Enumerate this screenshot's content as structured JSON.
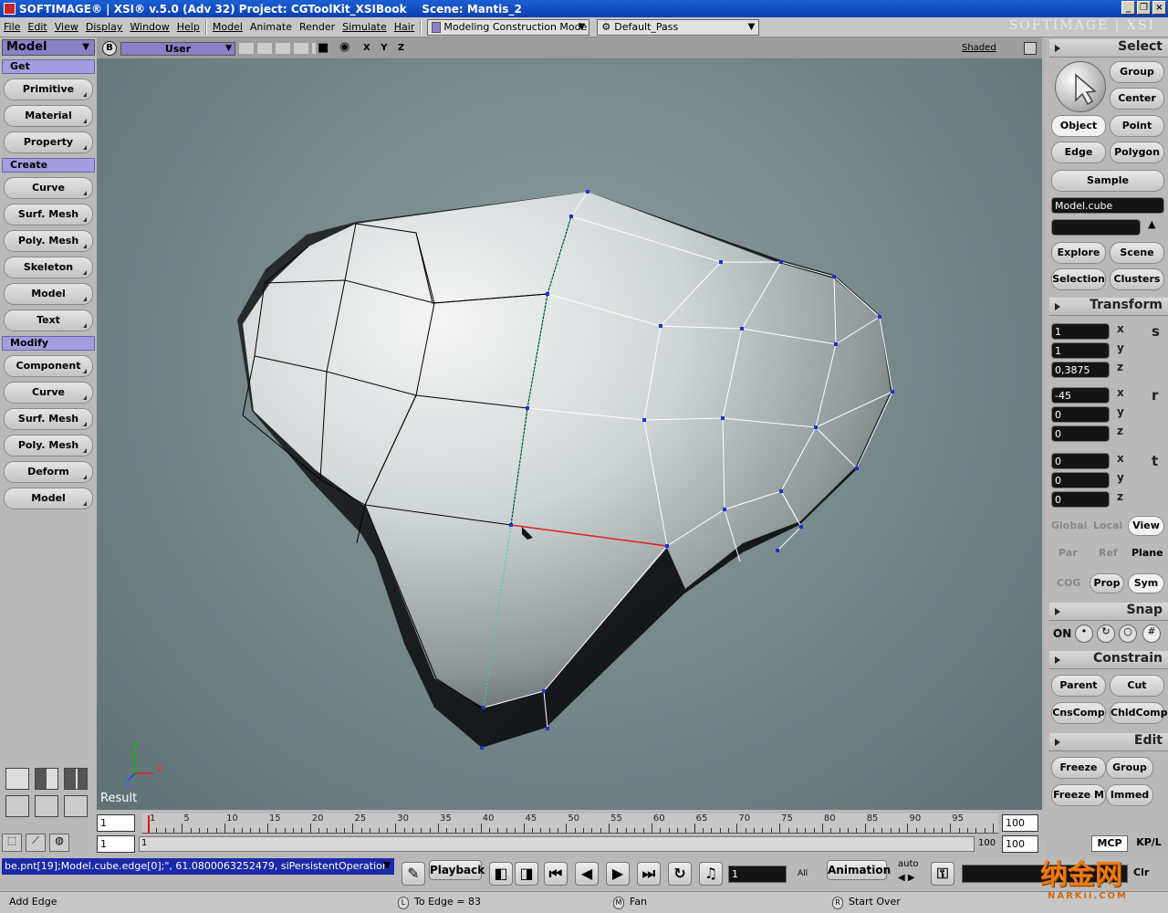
{
  "titlebar": {
    "text": "SOFTIMAGE® | XSI® v.5.0 (Adv 32) Project: CGToolKit_XSIBook    Scene: Mantis_2",
    "brand": "SOFTIMAGE | XSI"
  },
  "menubar": {
    "items": [
      "File",
      "Edit",
      "View",
      "Display",
      "Window",
      "Help"
    ],
    "modules": [
      "Model",
      "Animate",
      "Render",
      "Simulate",
      "Hair"
    ],
    "construction_mode": "Modeling Construction Mode",
    "pass": "Default_Pass"
  },
  "left_panel": {
    "mode": "Model",
    "sections": [
      {
        "title": "Get",
        "buttons": [
          "Primitive",
          "Material",
          "Property"
        ]
      },
      {
        "title": "Create",
        "buttons": [
          "Curve",
          "Surf. Mesh",
          "Poly. Mesh",
          "Skeleton",
          "Model",
          "Text"
        ]
      },
      {
        "title": "Modify",
        "buttons": [
          "Component",
          "Curve",
          "Surf. Mesh",
          "Poly. Mesh",
          "Deform",
          "Model"
        ]
      }
    ]
  },
  "viewport": {
    "letter": "B",
    "camera": "User",
    "axes": "X Y Z",
    "display_mode": "Shaded",
    "result_label": "Result",
    "axis_y": "Y",
    "axis_x": "X",
    "axis_z": "Z"
  },
  "right_panel": {
    "select_title": "Select",
    "group": "Group",
    "center": "Center",
    "object": "Object",
    "point": "Point",
    "edge": "Edge",
    "polygon": "Polygon",
    "sample": "Sample",
    "selection_field": "Model.cube",
    "explore": "Explore",
    "scene": "Scene",
    "selection": "Selection",
    "clusters": "Clusters",
    "transform_title": "Transform",
    "scale": {
      "x": "1",
      "y": "1",
      "z": "0,3875",
      "label": "s"
    },
    "rotate": {
      "x": "-45",
      "y": "0",
      "z": "0",
      "label": "r"
    },
    "translate": {
      "x": "0",
      "y": "0",
      "z": "0",
      "label": "t"
    },
    "axis_x": "x",
    "axis_y": "y",
    "axis_z": "z",
    "global": "Global",
    "local": "Local",
    "view": "View",
    "par": "Par",
    "ref": "Ref",
    "plane": "Plane",
    "cog": "COG",
    "prop": "Prop",
    "sym": "Sym",
    "snap_title": "Snap",
    "snap_on": "ON",
    "constrain_title": "Constrain",
    "parent": "Parent",
    "cut": "Cut",
    "cnscomp": "CnsComp",
    "chldcomp": "ChldComp",
    "edit_title": "Edit",
    "freeze": "Freeze",
    "group2": "Group",
    "freeze_m": "Freeze M",
    "immed": "Immed",
    "mcp": "MCP",
    "kpl": "KP/L"
  },
  "timeline": {
    "start": "1",
    "end": "100",
    "current": "1",
    "range_start": "1",
    "range_end": "100",
    "range_end2": "100",
    "ticks": [
      "1",
      "5",
      "10",
      "15",
      "20",
      "25",
      "30",
      "35",
      "40",
      "45",
      "50",
      "55",
      "60",
      "65",
      "70",
      "75",
      "80",
      "85",
      "90",
      "95"
    ]
  },
  "command_bar": {
    "command_text": "be.pnt[19];Model.cube.edge[0];\", 61.0800063252479, siPersistentOperation",
    "playback": "Playback",
    "frame": "1",
    "all": "All",
    "animation": "Animation",
    "auto": "auto",
    "clr": "Clr"
  },
  "statusbar": {
    "tool": "Add Edge",
    "left_mouse": "L",
    "left_action": "To Edge = 83",
    "middle_mouse": "M",
    "middle_action": "Fan",
    "right_mouse": "R",
    "right_action": "Start Over"
  },
  "watermark": {
    "text": "纳金网",
    "url": "NARKii.COM"
  },
  "colors": {
    "title": "#0a3fb0",
    "section": "#a49ee0",
    "selected_edge": "#e02020",
    "wire_selected": "#ffffff",
    "wire": "#000000",
    "vertex": "#2030d0",
    "command": "#1b2aa8"
  }
}
